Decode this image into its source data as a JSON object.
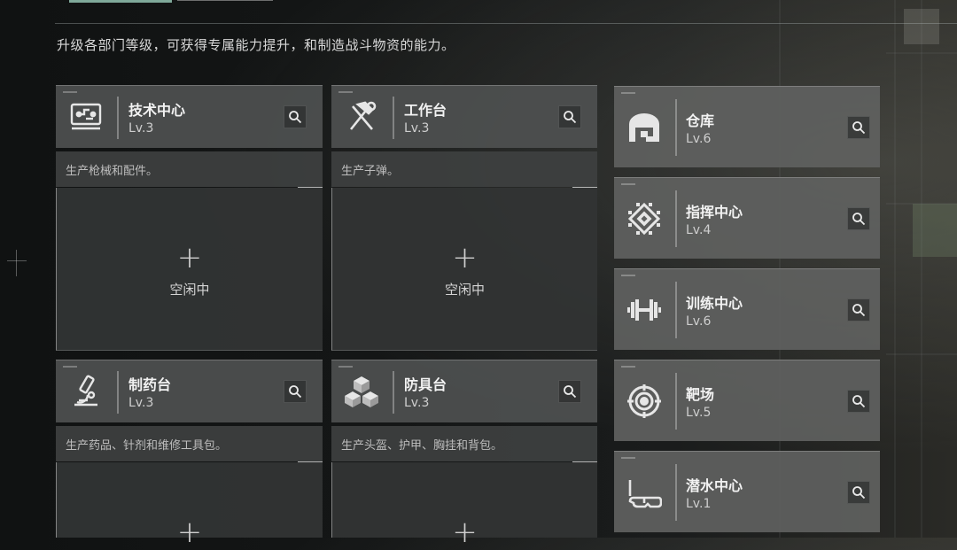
{
  "intro_text": "升级各部门等级，可获得专属能力提升，和制造战斗物资的能力。",
  "left_columns": [
    {
      "title": "技术中心",
      "level": "Lv.3",
      "icon": "computer-icon",
      "description": "生产枪械和配件。",
      "slot_status": "空闲中",
      "slot_plus": "+"
    },
    {
      "title": "工作台",
      "level": "Lv.3",
      "icon": "hammer-wrench-icon",
      "description": "生产子弹。",
      "slot_status": "空闲中",
      "slot_plus": "+"
    },
    {
      "title": "制药台",
      "level": "Lv.3",
      "icon": "microscope-icon",
      "description": "生产药品、针剂和维修工具包。",
      "slot_status": "",
      "slot_plus": "+"
    },
    {
      "title": "防具台",
      "level": "Lv.3",
      "icon": "cubes-icon",
      "description": "生产头盔、护甲、胸挂和背包。",
      "slot_status": "",
      "slot_plus": "+"
    }
  ],
  "right_column": [
    {
      "title": "仓库",
      "level": "Lv.6",
      "icon": "warehouse-icon"
    },
    {
      "title": "指挥中心",
      "level": "Lv.4",
      "icon": "chip-icon"
    },
    {
      "title": "训练中心",
      "level": "Lv.6",
      "icon": "dumbbell-icon"
    },
    {
      "title": "靶场",
      "level": "Lv.5",
      "icon": "target-icon"
    },
    {
      "title": "潜水中心",
      "level": "Lv.1",
      "icon": "diving-mask-icon"
    }
  ]
}
